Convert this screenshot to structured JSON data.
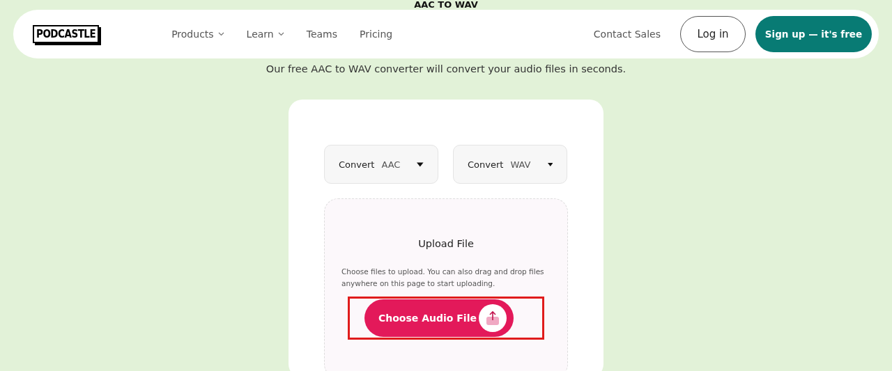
{
  "page_heading": "AAC TO WAV",
  "nav": {
    "logo": "PODCASTLE",
    "links": [
      {
        "label": "Products",
        "dropdown": true
      },
      {
        "label": "Learn",
        "dropdown": true
      },
      {
        "label": "Teams",
        "dropdown": false
      },
      {
        "label": "Pricing",
        "dropdown": false
      }
    ],
    "contact": "Contact Sales",
    "login": "Log in",
    "signup": "Sign up — it's free"
  },
  "subtitle": "Our free AAC to WAV converter will convert your audio files in seconds.",
  "converter": {
    "selects": [
      {
        "label": "Convert",
        "value": "AAC"
      },
      {
        "label": "Convert",
        "value": "WAV"
      }
    ],
    "upload": {
      "title": "Upload File",
      "description": "Choose files to upload. You can also drag and drop files anywhere on this page to start uploading.",
      "button": "Choose Audio File",
      "highlighted": true
    }
  }
}
